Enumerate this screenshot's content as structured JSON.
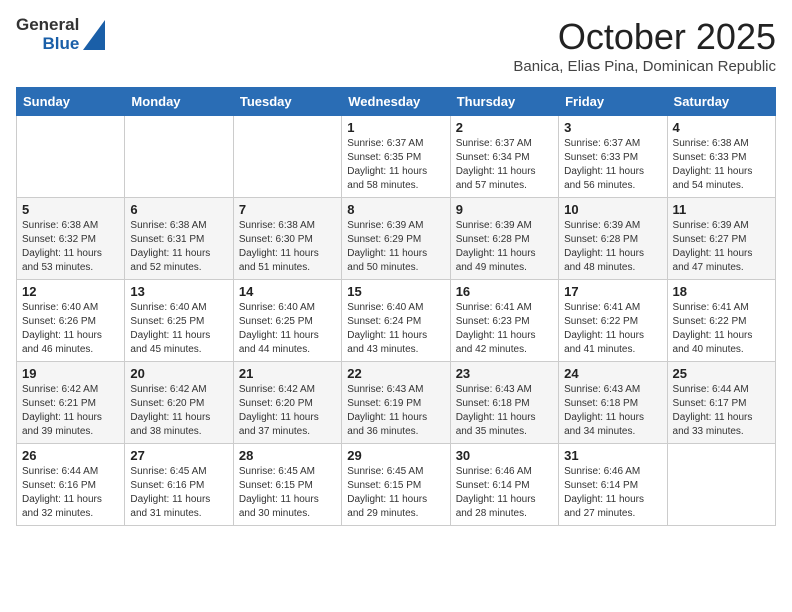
{
  "logo": {
    "general": "General",
    "blue": "Blue"
  },
  "header": {
    "month": "October 2025",
    "location": "Banica, Elias Pina, Dominican Republic"
  },
  "weekdays": [
    "Sunday",
    "Monday",
    "Tuesday",
    "Wednesday",
    "Thursday",
    "Friday",
    "Saturday"
  ],
  "weeks": [
    [
      {
        "day": "",
        "sunrise": "",
        "sunset": "",
        "daylight": ""
      },
      {
        "day": "",
        "sunrise": "",
        "sunset": "",
        "daylight": ""
      },
      {
        "day": "",
        "sunrise": "",
        "sunset": "",
        "daylight": ""
      },
      {
        "day": "1",
        "sunrise": "6:37 AM",
        "sunset": "6:35 PM",
        "daylight": "11 hours and 58 minutes."
      },
      {
        "day": "2",
        "sunrise": "6:37 AM",
        "sunset": "6:34 PM",
        "daylight": "11 hours and 57 minutes."
      },
      {
        "day": "3",
        "sunrise": "6:37 AM",
        "sunset": "6:33 PM",
        "daylight": "11 hours and 56 minutes."
      },
      {
        "day": "4",
        "sunrise": "6:38 AM",
        "sunset": "6:33 PM",
        "daylight": "11 hours and 54 minutes."
      }
    ],
    [
      {
        "day": "5",
        "sunrise": "6:38 AM",
        "sunset": "6:32 PM",
        "daylight": "11 hours and 53 minutes."
      },
      {
        "day": "6",
        "sunrise": "6:38 AM",
        "sunset": "6:31 PM",
        "daylight": "11 hours and 52 minutes."
      },
      {
        "day": "7",
        "sunrise": "6:38 AM",
        "sunset": "6:30 PM",
        "daylight": "11 hours and 51 minutes."
      },
      {
        "day": "8",
        "sunrise": "6:39 AM",
        "sunset": "6:29 PM",
        "daylight": "11 hours and 50 minutes."
      },
      {
        "day": "9",
        "sunrise": "6:39 AM",
        "sunset": "6:28 PM",
        "daylight": "11 hours and 49 minutes."
      },
      {
        "day": "10",
        "sunrise": "6:39 AM",
        "sunset": "6:28 PM",
        "daylight": "11 hours and 48 minutes."
      },
      {
        "day": "11",
        "sunrise": "6:39 AM",
        "sunset": "6:27 PM",
        "daylight": "11 hours and 47 minutes."
      }
    ],
    [
      {
        "day": "12",
        "sunrise": "6:40 AM",
        "sunset": "6:26 PM",
        "daylight": "11 hours and 46 minutes."
      },
      {
        "day": "13",
        "sunrise": "6:40 AM",
        "sunset": "6:25 PM",
        "daylight": "11 hours and 45 minutes."
      },
      {
        "day": "14",
        "sunrise": "6:40 AM",
        "sunset": "6:25 PM",
        "daylight": "11 hours and 44 minutes."
      },
      {
        "day": "15",
        "sunrise": "6:40 AM",
        "sunset": "6:24 PM",
        "daylight": "11 hours and 43 minutes."
      },
      {
        "day": "16",
        "sunrise": "6:41 AM",
        "sunset": "6:23 PM",
        "daylight": "11 hours and 42 minutes."
      },
      {
        "day": "17",
        "sunrise": "6:41 AM",
        "sunset": "6:22 PM",
        "daylight": "11 hours and 41 minutes."
      },
      {
        "day": "18",
        "sunrise": "6:41 AM",
        "sunset": "6:22 PM",
        "daylight": "11 hours and 40 minutes."
      }
    ],
    [
      {
        "day": "19",
        "sunrise": "6:42 AM",
        "sunset": "6:21 PM",
        "daylight": "11 hours and 39 minutes."
      },
      {
        "day": "20",
        "sunrise": "6:42 AM",
        "sunset": "6:20 PM",
        "daylight": "11 hours and 38 minutes."
      },
      {
        "day": "21",
        "sunrise": "6:42 AM",
        "sunset": "6:20 PM",
        "daylight": "11 hours and 37 minutes."
      },
      {
        "day": "22",
        "sunrise": "6:43 AM",
        "sunset": "6:19 PM",
        "daylight": "11 hours and 36 minutes."
      },
      {
        "day": "23",
        "sunrise": "6:43 AM",
        "sunset": "6:18 PM",
        "daylight": "11 hours and 35 minutes."
      },
      {
        "day": "24",
        "sunrise": "6:43 AM",
        "sunset": "6:18 PM",
        "daylight": "11 hours and 34 minutes."
      },
      {
        "day": "25",
        "sunrise": "6:44 AM",
        "sunset": "6:17 PM",
        "daylight": "11 hours and 33 minutes."
      }
    ],
    [
      {
        "day": "26",
        "sunrise": "6:44 AM",
        "sunset": "6:16 PM",
        "daylight": "11 hours and 32 minutes."
      },
      {
        "day": "27",
        "sunrise": "6:45 AM",
        "sunset": "6:16 PM",
        "daylight": "11 hours and 31 minutes."
      },
      {
        "day": "28",
        "sunrise": "6:45 AM",
        "sunset": "6:15 PM",
        "daylight": "11 hours and 30 minutes."
      },
      {
        "day": "29",
        "sunrise": "6:45 AM",
        "sunset": "6:15 PM",
        "daylight": "11 hours and 29 minutes."
      },
      {
        "day": "30",
        "sunrise": "6:46 AM",
        "sunset": "6:14 PM",
        "daylight": "11 hours and 28 minutes."
      },
      {
        "day": "31",
        "sunrise": "6:46 AM",
        "sunset": "6:14 PM",
        "daylight": "11 hours and 27 minutes."
      },
      {
        "day": "",
        "sunrise": "",
        "sunset": "",
        "daylight": ""
      }
    ]
  ],
  "labels": {
    "sunrise": "Sunrise:",
    "sunset": "Sunset:",
    "daylight": "Daylight:"
  }
}
